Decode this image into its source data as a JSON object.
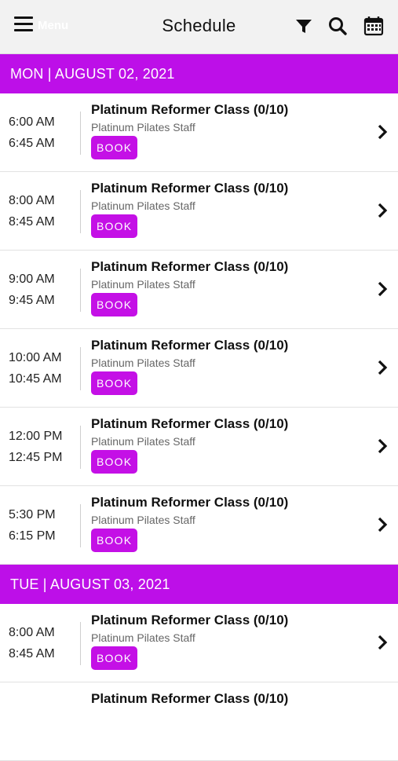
{
  "header": {
    "menu_label": "Menu",
    "title": "Schedule",
    "icons": [
      "menu-icon",
      "filter-icon",
      "search-icon",
      "calendar-icon"
    ]
  },
  "colors": {
    "accent": "#bd0fe8",
    "book": "#c410e6",
    "topbar": "#f2f2f2"
  },
  "days": [
    {
      "label": "MON | AUGUST 02, 2021",
      "classes": [
        {
          "start": "6:00 AM",
          "end": "6:45 AM",
          "name": "Platinum Reformer Class (0/10)",
          "staff": "Platinum Pilates Staff",
          "action": "BOOK"
        },
        {
          "start": "8:00 AM",
          "end": "8:45 AM",
          "name": "Platinum Reformer Class (0/10)",
          "staff": "Platinum Pilates Staff",
          "action": "BOOK"
        },
        {
          "start": "9:00 AM",
          "end": "9:45 AM",
          "name": "Platinum Reformer Class (0/10)",
          "staff": "Platinum Pilates Staff",
          "action": "BOOK"
        },
        {
          "start": "10:00 AM",
          "end": "10:45 AM",
          "name": "Platinum Reformer Class (0/10)",
          "staff": "Platinum Pilates Staff",
          "action": "BOOK"
        },
        {
          "start": "12:00 PM",
          "end": "12:45 PM",
          "name": "Platinum Reformer Class (0/10)",
          "staff": "Platinum Pilates Staff",
          "action": "BOOK"
        },
        {
          "start": "5:30 PM",
          "end": "6:15 PM",
          "name": "Platinum Reformer Class (0/10)",
          "staff": "Platinum Pilates Staff",
          "action": "BOOK"
        }
      ]
    },
    {
      "label": "TUE | AUGUST 03, 2021",
      "classes": [
        {
          "start": "8:00 AM",
          "end": "8:45 AM",
          "name": "Platinum Reformer Class (0/10)",
          "staff": "Platinum Pilates Staff",
          "action": "BOOK"
        },
        {
          "start": "",
          "end": "",
          "name": "Platinum Reformer Class (0/10)",
          "staff": "",
          "action": ""
        }
      ]
    }
  ]
}
